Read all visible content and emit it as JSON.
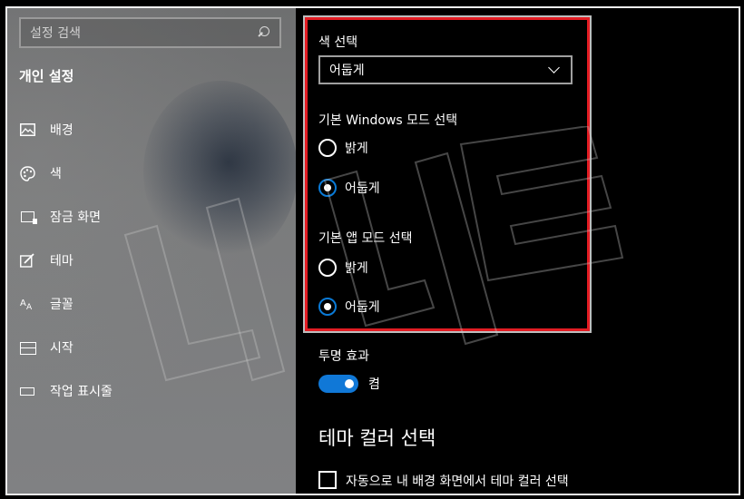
{
  "sidebar": {
    "search_placeholder": "설정 검색",
    "section_title": "개인 설정",
    "items": [
      {
        "label": "배경",
        "icon": "image-icon"
      },
      {
        "label": "색",
        "icon": "palette-icon"
      },
      {
        "label": "잠금 화면",
        "icon": "lock-screen-icon"
      },
      {
        "label": "테마",
        "icon": "theme-icon"
      },
      {
        "label": "글꼴",
        "icon": "font-icon"
      },
      {
        "label": "시작",
        "icon": "start-icon"
      },
      {
        "label": "작업 표시줄",
        "icon": "taskbar-icon"
      }
    ]
  },
  "content": {
    "color_choice_label": "색 선택",
    "color_choice_value": "어둡게",
    "windows_mode_label": "기본 Windows 모드 선택",
    "windows_mode_options": [
      "밝게",
      "어둡게"
    ],
    "windows_mode_selected": "어둡게",
    "app_mode_label": "기본 앱 모드 선택",
    "app_mode_options": [
      "밝게",
      "어둡게"
    ],
    "app_mode_selected": "어둡게",
    "transparency_label": "투명 효과",
    "transparency_state": "켬",
    "accent_heading": "테마 컬러 선택",
    "auto_accent_label": "자동으로 내 배경 화면에서 테마 컬러 선택"
  },
  "colors": {
    "accent": "#1078d7",
    "highlight_border": "#e31c23"
  }
}
